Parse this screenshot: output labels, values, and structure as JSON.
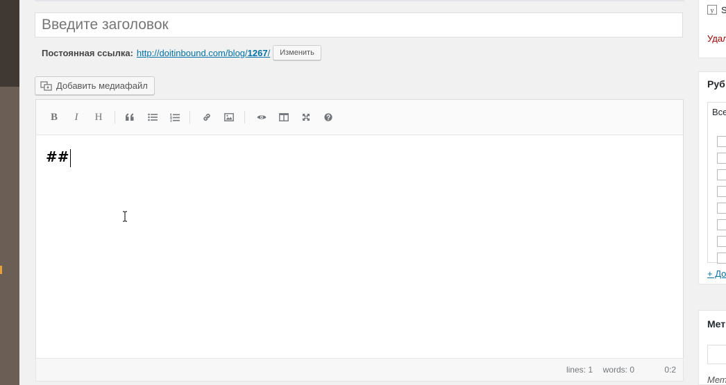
{
  "post": {
    "title_placeholder": "Введите заголовок",
    "permalink_label": "Постоянная ссылка:",
    "permalink_base": "http://doitinbound.com/blog/",
    "permalink_slug": "1267",
    "permalink_trailing": "/",
    "change_button": "Изменить"
  },
  "media": {
    "add_button": "Добавить медиафайл"
  },
  "toolbar": {
    "bold": "B",
    "italic": "I",
    "heading": "H"
  },
  "editor": {
    "content": "##"
  },
  "status": {
    "lines": "lines: 1",
    "words": "words: 0",
    "cursor": "0:2"
  },
  "sidebar": {
    "publish": {
      "s_fragment": "S",
      "delete_fragment": "Удал"
    },
    "categories": {
      "title_fragment": "Руб",
      "tab_fragment": "Все",
      "add_fragment": "+ До"
    },
    "meta": {
      "title_fragment": "Мет",
      "label_fragment": "Мет"
    }
  }
}
